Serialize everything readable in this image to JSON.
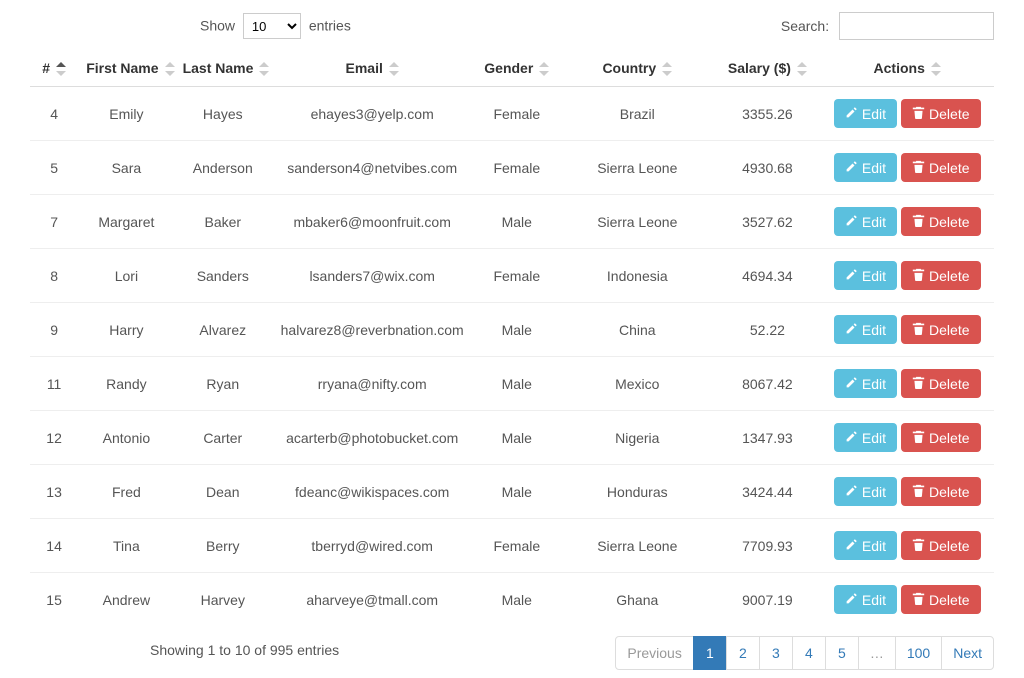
{
  "lengthControl": {
    "prefix": "Show",
    "suffix": "entries",
    "value": "10"
  },
  "searchControl": {
    "label": "Search:",
    "value": ""
  },
  "columns": [
    {
      "label": "#"
    },
    {
      "label": "First Name"
    },
    {
      "label": "Last Name"
    },
    {
      "label": "Email"
    },
    {
      "label": "Gender"
    },
    {
      "label": "Country"
    },
    {
      "label": "Salary ($)"
    },
    {
      "label": "Actions"
    }
  ],
  "actions": {
    "edit": "Edit",
    "delete": "Delete"
  },
  "rows": [
    {
      "num": "4",
      "first": "Emily",
      "last": "Hayes",
      "email": "ehayes3@yelp.com",
      "gender": "Female",
      "country": "Brazil",
      "salary": "3355.26"
    },
    {
      "num": "5",
      "first": "Sara",
      "last": "Anderson",
      "email": "sanderson4@netvibes.com",
      "gender": "Female",
      "country": "Sierra Leone",
      "salary": "4930.68"
    },
    {
      "num": "7",
      "first": "Margaret",
      "last": "Baker",
      "email": "mbaker6@moonfruit.com",
      "gender": "Male",
      "country": "Sierra Leone",
      "salary": "3527.62"
    },
    {
      "num": "8",
      "first": "Lori",
      "last": "Sanders",
      "email": "lsanders7@wix.com",
      "gender": "Female",
      "country": "Indonesia",
      "salary": "4694.34"
    },
    {
      "num": "9",
      "first": "Harry",
      "last": "Alvarez",
      "email": "halvarez8@reverbnation.com",
      "gender": "Male",
      "country": "China",
      "salary": "52.22"
    },
    {
      "num": "11",
      "first": "Randy",
      "last": "Ryan",
      "email": "rryana@nifty.com",
      "gender": "Male",
      "country": "Mexico",
      "salary": "8067.42"
    },
    {
      "num": "12",
      "first": "Antonio",
      "last": "Carter",
      "email": "acarterb@photobucket.com",
      "gender": "Male",
      "country": "Nigeria",
      "salary": "1347.93"
    },
    {
      "num": "13",
      "first": "Fred",
      "last": "Dean",
      "email": "fdeanc@wikispaces.com",
      "gender": "Male",
      "country": "Honduras",
      "salary": "3424.44"
    },
    {
      "num": "14",
      "first": "Tina",
      "last": "Berry",
      "email": "tberryd@wired.com",
      "gender": "Female",
      "country": "Sierra Leone",
      "salary": "7709.93"
    },
    {
      "num": "15",
      "first": "Andrew",
      "last": "Harvey",
      "email": "aharveye@tmall.com",
      "gender": "Male",
      "country": "Ghana",
      "salary": "9007.19"
    }
  ],
  "info": "Showing 1 to 10 of 995 entries",
  "pagination": {
    "prev": "Previous",
    "next": "Next",
    "pages": [
      "1",
      "2",
      "3",
      "4",
      "5",
      "…",
      "100"
    ],
    "activeIndex": 0
  }
}
